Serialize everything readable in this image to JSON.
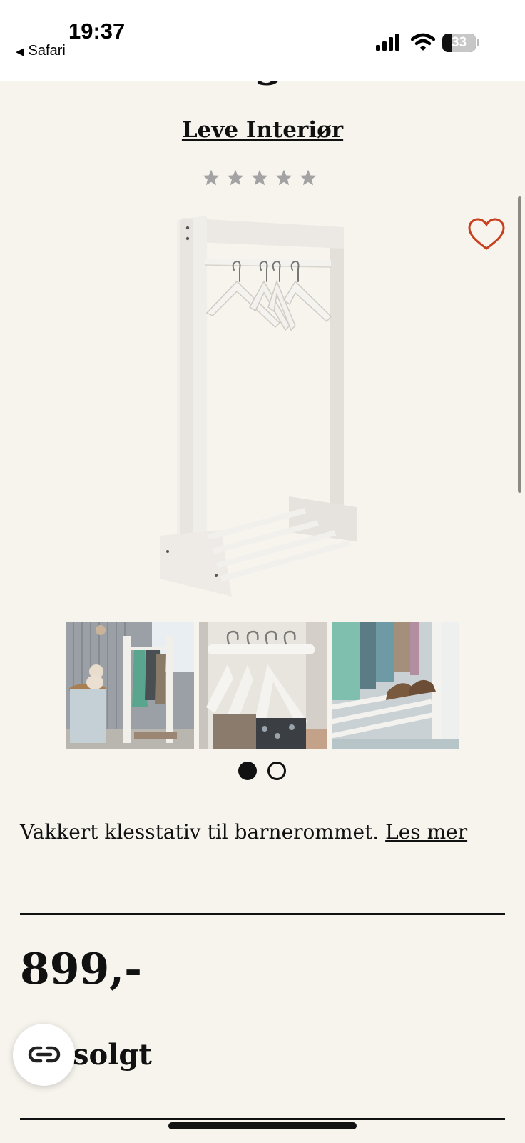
{
  "status_bar": {
    "time": "19:37",
    "back_app": "Safari",
    "back_glyph": "◀",
    "battery": "33"
  },
  "product": {
    "title_partial": "hengere",
    "brand": "Leve Interiør",
    "rating_stars": 0,
    "rating_max": 5,
    "description": "Vakkert klesstativ til barnerommet.",
    "read_more": "Les mer",
    "price": "899,-",
    "stock_status": "solgt"
  },
  "gallery": {
    "thumbnail_count": 3,
    "page_count": 2,
    "active_page": 1
  },
  "colors": {
    "background": "#f7f4ee",
    "heart": "#c8401e",
    "star": "#a3a3a3",
    "text": "#111111"
  },
  "icons": {
    "favorite": "heart-outline-icon",
    "rating": "star-icon",
    "link_fab": "link-icon"
  }
}
